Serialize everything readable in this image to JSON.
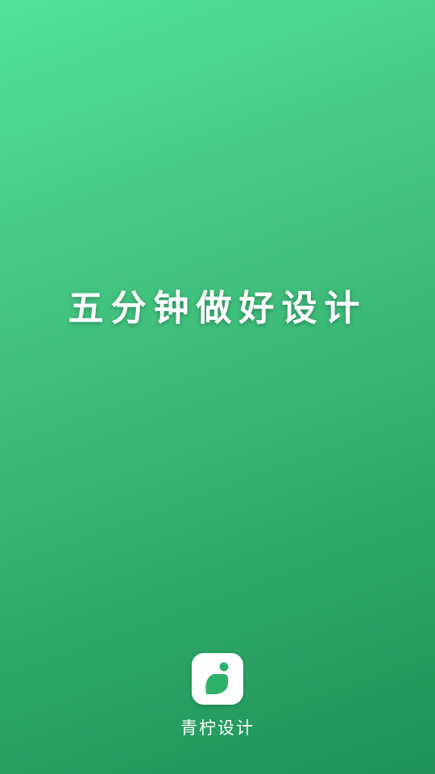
{
  "splash": {
    "tagline": "五分钟做好设计",
    "app_name": "青柠设计",
    "app_icon": "lime-leaf-logo-icon"
  },
  "colors": {
    "gradient_top": "#52E39A",
    "gradient_bottom": "#1F9257",
    "icon_background": "#FFFFFF",
    "logo_green": "#2FB16C",
    "text": "#FFFFFF"
  }
}
